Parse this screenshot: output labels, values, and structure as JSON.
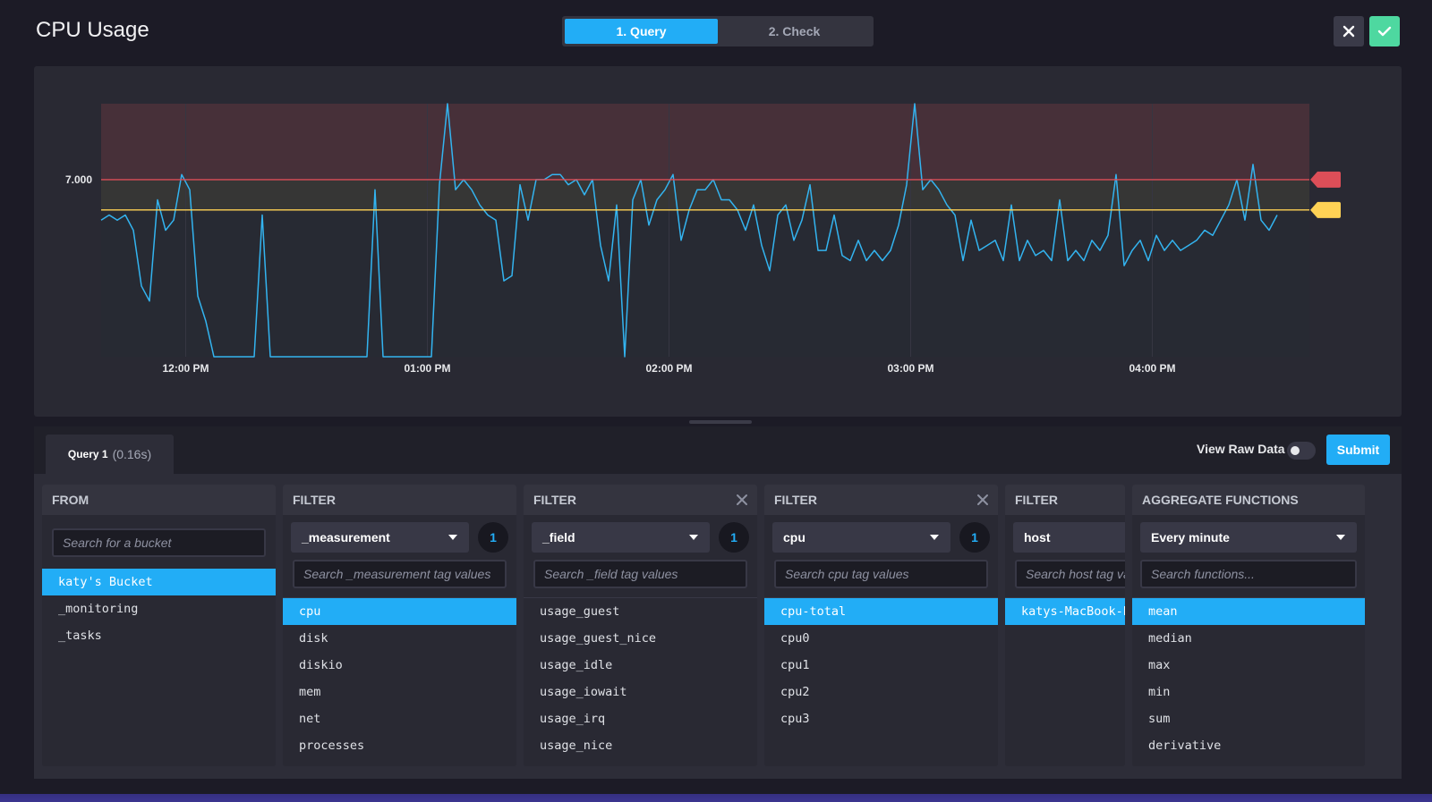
{
  "header": {
    "title": "CPU Usage",
    "steps": [
      {
        "label": "1. Query",
        "active": true
      },
      {
        "label": "2. Check",
        "active": false
      }
    ],
    "close_icon": "close-icon",
    "confirm_icon": "checkmark-icon",
    "confirm_color": "#4ed8a0"
  },
  "chart_data": {
    "type": "line",
    "y_tick_labels": [
      "7.000"
    ],
    "x_tick_labels": [
      "12:00 PM",
      "01:00 PM",
      "02:00 PM",
      "03:00 PM",
      "04:00 PM"
    ],
    "thresholds": [
      {
        "level": "crit",
        "value": 7.0,
        "color": "#dc4e58"
      },
      {
        "level": "warn",
        "value": 6.4,
        "color": "#ffd255"
      }
    ],
    "ylim": [
      3.5,
      8.5
    ],
    "xlim_minutes": [
      -21,
      279
    ],
    "series": [
      {
        "color": "#4591ed",
        "x_minutes": [
          -21,
          -19,
          -17,
          -15,
          -13,
          -11,
          -9,
          -7,
          -5,
          -3,
          -1,
          1,
          3,
          5,
          7,
          9,
          11,
          13,
          15,
          17,
          19,
          21,
          23,
          25,
          27,
          29,
          31,
          33,
          35,
          37,
          39,
          41,
          43,
          45,
          47,
          49,
          51,
          53,
          55,
          57,
          59,
          61,
          63,
          65,
          67,
          69,
          71,
          73,
          75,
          77,
          79,
          81,
          83,
          85,
          87,
          89,
          91,
          93,
          95,
          97,
          99,
          101,
          103,
          105,
          107,
          109,
          111,
          113,
          115,
          117,
          119,
          121,
          123,
          125,
          127,
          129,
          131,
          133,
          135,
          137,
          139,
          141,
          143,
          145,
          147,
          149,
          151,
          153,
          155,
          157,
          159,
          161,
          163,
          165,
          167,
          169,
          171,
          173,
          175,
          177,
          179,
          181,
          183,
          185,
          187,
          189,
          191,
          193,
          195,
          197,
          199,
          201,
          203,
          205,
          207,
          209,
          211,
          213,
          215,
          217,
          219,
          221,
          223,
          225,
          227,
          229,
          231,
          233,
          235,
          237,
          239,
          241,
          243,
          245,
          247,
          249,
          251,
          253,
          255,
          257,
          259,
          261,
          263,
          265,
          267,
          269,
          271,
          273,
          275,
          277,
          279
        ],
        "values": [
          6.2,
          6.3,
          6.2,
          6.3,
          6.0,
          4.9,
          4.6,
          6.6,
          6.0,
          6.2,
          7.1,
          6.8,
          4.7,
          4.2,
          3.5,
          3.5,
          3.5,
          3.5,
          3.5,
          3.5,
          6.3,
          3.5,
          3.5,
          3.5,
          3.5,
          3.5,
          3.5,
          3.5,
          3.5,
          3.5,
          3.5,
          3.5,
          3.5,
          3.5,
          6.8,
          3.5,
          3.5,
          3.5,
          3.5,
          3.5,
          3.5,
          3.5,
          6.9,
          8.5,
          6.8,
          7.0,
          6.8,
          6.5,
          6.3,
          6.2,
          5.0,
          5.1,
          6.9,
          6.2,
          7.0,
          7.0,
          7.1,
          7.1,
          6.9,
          7.0,
          6.7,
          7.0,
          5.7,
          5.0,
          6.5,
          3.5,
          6.6,
          7.0,
          6.1,
          6.6,
          6.8,
          7.1,
          5.8,
          6.4,
          6.8,
          6.8,
          7.0,
          6.6,
          6.6,
          6.4,
          6.0,
          6.5,
          5.7,
          5.2,
          6.3,
          6.5,
          5.8,
          6.2,
          6.9,
          5.6,
          5.6,
          6.3,
          5.5,
          5.4,
          5.8,
          5.4,
          5.6,
          5.4,
          5.6,
          6.1,
          6.9,
          8.5,
          6.8,
          7.0,
          6.8,
          6.5,
          6.3,
          5.4,
          6.2,
          5.6,
          5.7,
          5.8,
          5.4,
          6.5,
          5.4,
          5.8,
          5.5,
          5.6,
          5.4,
          6.6,
          5.4,
          5.6,
          5.4,
          5.8,
          5.6,
          5.9,
          7.1,
          5.3,
          5.6,
          5.8,
          5.4,
          5.9,
          5.6,
          5.8,
          5.6,
          5.7,
          5.8,
          6.0,
          5.9,
          6.2,
          6.5,
          7.0,
          6.2,
          7.3,
          6.2,
          6.0,
          6.3
        ]
      }
    ]
  },
  "query": {
    "tab_name": "Query 1",
    "tab_time": "(0.16s)",
    "view_raw_label": "View Raw Data",
    "view_raw_on": false,
    "submit_label": "Submit"
  },
  "from_card": {
    "title": "FROM",
    "search_placeholder": "Search for a bucket",
    "items": [
      {
        "label": "katy's Bucket",
        "selected": true
      },
      {
        "label": "_monitoring",
        "selected": false
      },
      {
        "label": "_tasks",
        "selected": false
      }
    ]
  },
  "filters": [
    {
      "title": "FILTER",
      "closable": false,
      "key": "_measurement",
      "count": "1",
      "search_placeholder": "Search _measurement tag values",
      "items": [
        {
          "label": "cpu",
          "selected": true
        },
        {
          "label": "disk",
          "selected": false
        },
        {
          "label": "diskio",
          "selected": false
        },
        {
          "label": "mem",
          "selected": false
        },
        {
          "label": "net",
          "selected": false
        },
        {
          "label": "processes",
          "selected": false
        }
      ]
    },
    {
      "title": "FILTER",
      "closable": true,
      "key": "_field",
      "count": "1",
      "search_placeholder": "Search _field tag values",
      "items": [
        {
          "label": "usage_guest",
          "selected": false
        },
        {
          "label": "usage_guest_nice",
          "selected": false
        },
        {
          "label": "usage_idle",
          "selected": false
        },
        {
          "label": "usage_iowait",
          "selected": false
        },
        {
          "label": "usage_irq",
          "selected": false
        },
        {
          "label": "usage_nice",
          "selected": false
        }
      ]
    },
    {
      "title": "FILTER",
      "closable": true,
      "key": "cpu",
      "count": "1",
      "search_placeholder": "Search cpu tag values",
      "items": [
        {
          "label": "cpu-total",
          "selected": true
        },
        {
          "label": "cpu0",
          "selected": false
        },
        {
          "label": "cpu1",
          "selected": false
        },
        {
          "label": "cpu2",
          "selected": false
        },
        {
          "label": "cpu3",
          "selected": false
        }
      ]
    },
    {
      "title": "FILTER",
      "closable": false,
      "key": "host",
      "count": "",
      "search_placeholder": "Search host tag values",
      "items": [
        {
          "label": "katys-MacBook-Pro.local",
          "selected": true
        }
      ]
    }
  ],
  "aggregate": {
    "title": "AGGREGATE FUNCTIONS",
    "window": "Every minute",
    "search_placeholder": "Search functions...",
    "items": [
      {
        "label": "mean",
        "selected": true
      },
      {
        "label": "median",
        "selected": false
      },
      {
        "label": "max",
        "selected": false
      },
      {
        "label": "min",
        "selected": false
      },
      {
        "label": "sum",
        "selected": false
      },
      {
        "label": "derivative",
        "selected": false
      }
    ]
  }
}
